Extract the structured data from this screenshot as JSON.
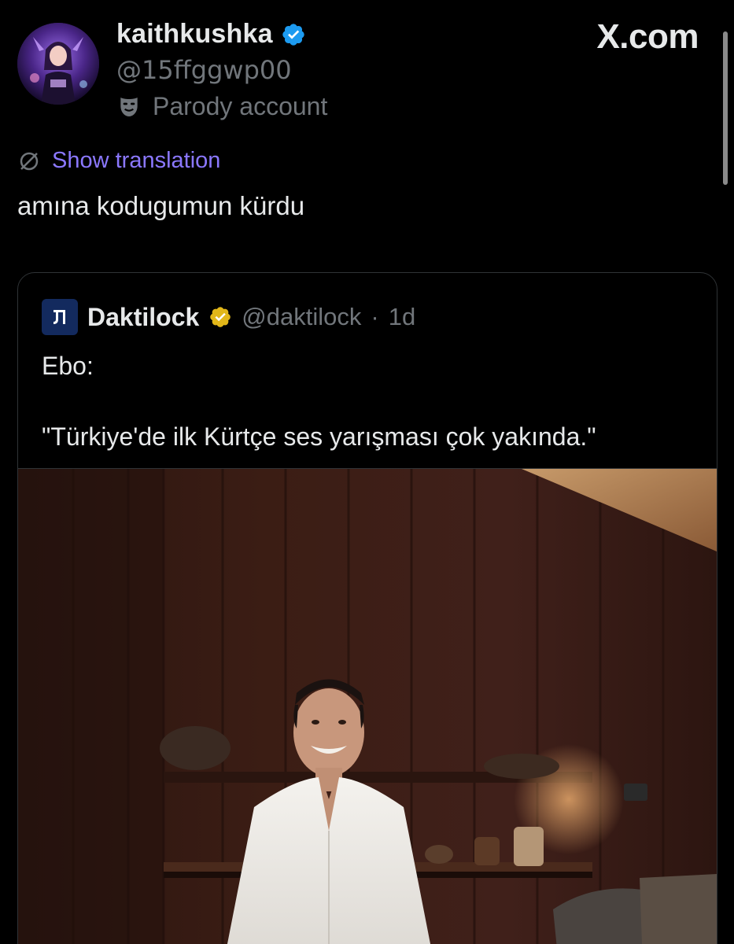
{
  "header": {
    "author_name": "kaithkushka",
    "author_handle": "@15ffggwp00",
    "parody_label": "Parody account",
    "site_logo": "X.com",
    "avatar_icon": "avatar-image",
    "verified_icon": "verified-badge-icon",
    "parody_icon": "theater-mask-icon",
    "colors": {
      "verified_blue": "#1d9bf0",
      "muted_text": "#71767b",
      "link_purple": "#8b78ff"
    }
  },
  "translation": {
    "label": "Show translation",
    "icon": "translate-icon"
  },
  "tweet": {
    "text": "amına kodugumun kürdu"
  },
  "quote": {
    "avatar_text": "Ɲ",
    "name": "Daktilock",
    "handle": "@daktilock",
    "separator": "·",
    "time": "1d",
    "line1": "Ebo:",
    "line2": "\"Türkiye'de ilk Kürtçe ses yarışması çok yakında.\"",
    "verified_icon": "gold-verified-badge-icon",
    "colors": {
      "verified_gold": "#e2b719",
      "avatar_bg": "#132a5e"
    },
    "media_description_icon": "photo-media"
  }
}
